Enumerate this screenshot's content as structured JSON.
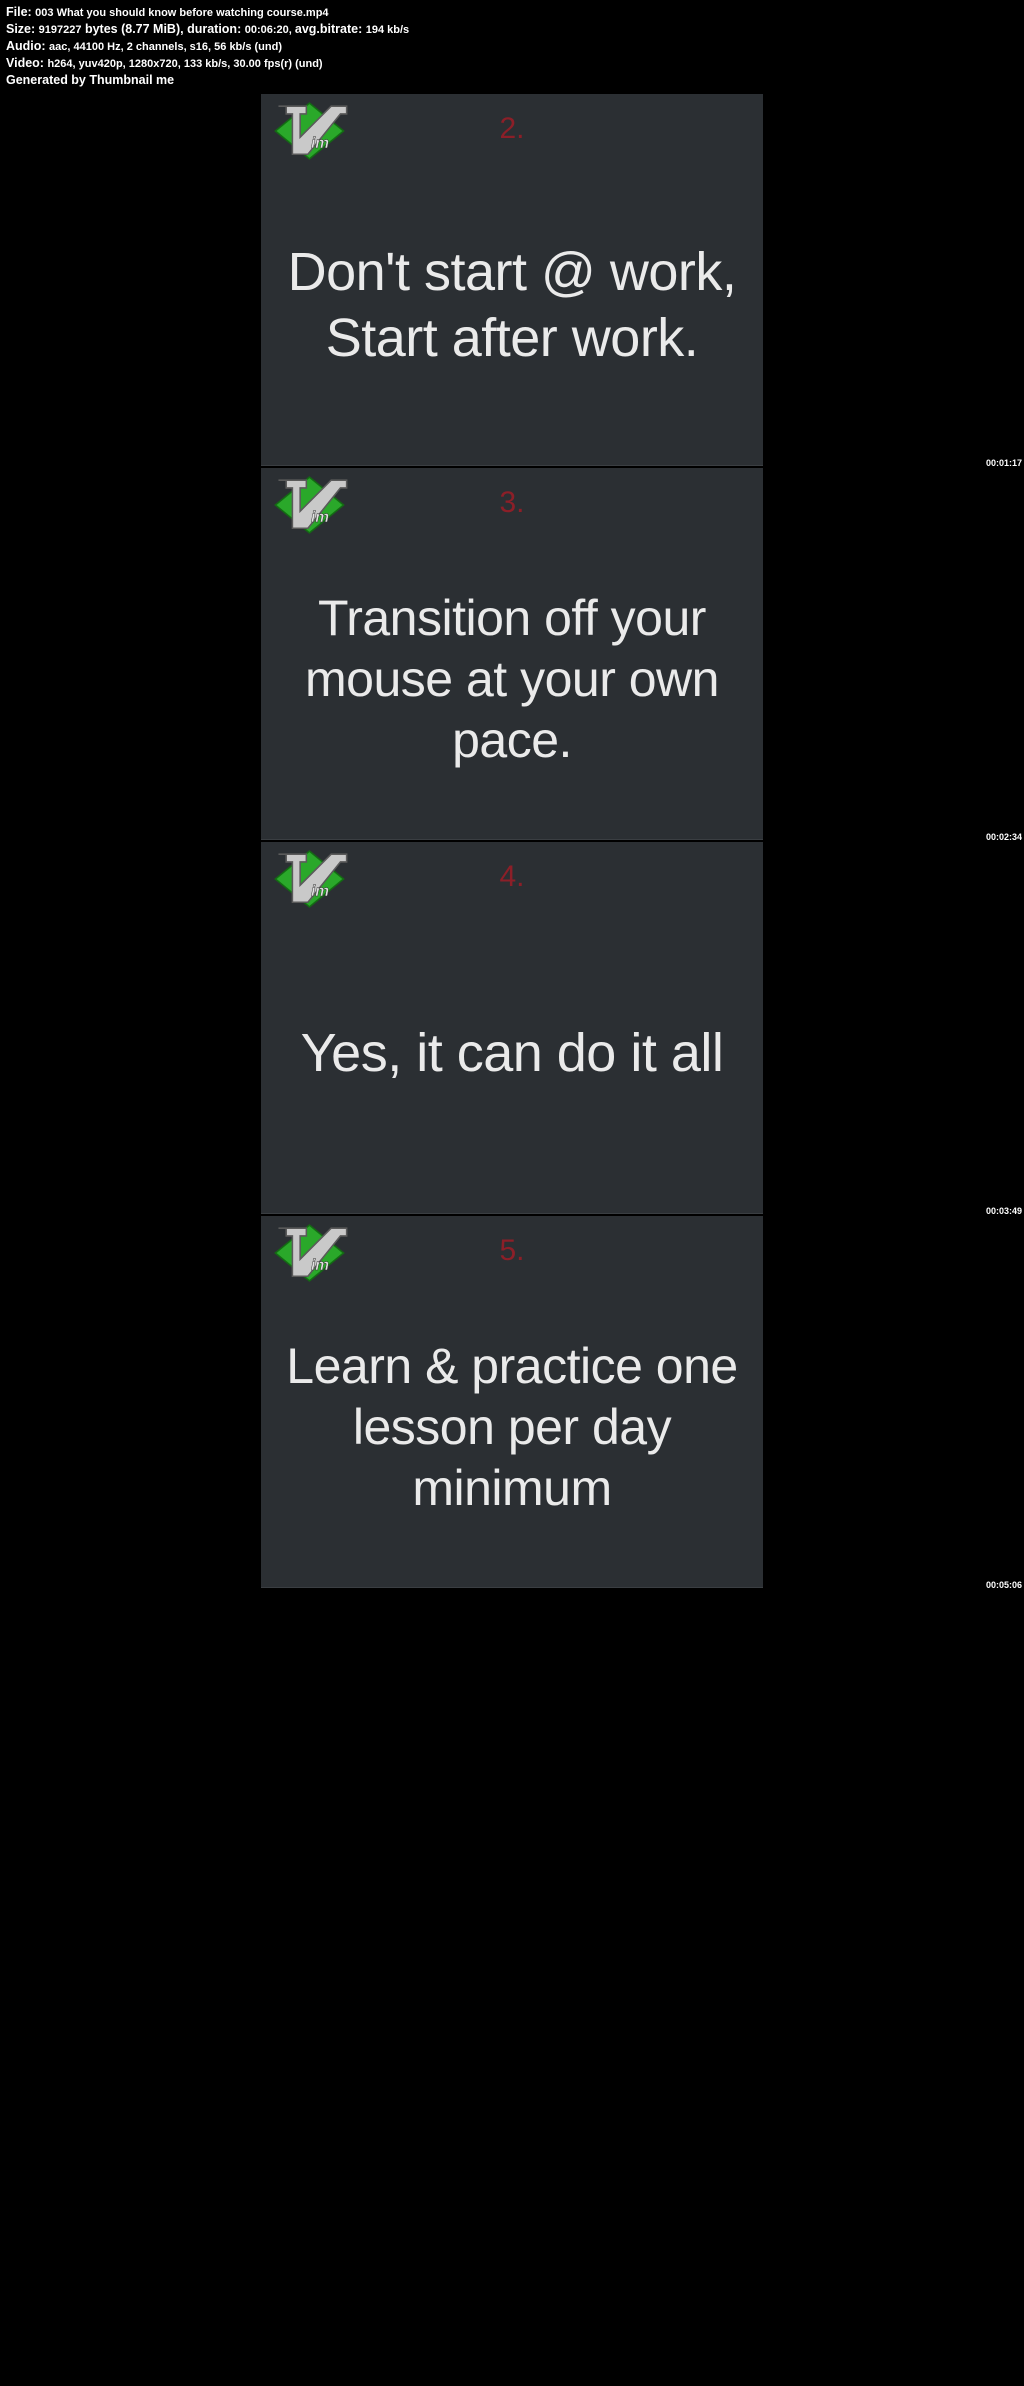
{
  "info": {
    "file_label": "File: ",
    "file": "003 What you should know before watching course.mp4",
    "size_label": "Size: ",
    "size_bytes": "9197227",
    "size_mib": " bytes (8.77 MiB), ",
    "duration_label": "duration: ",
    "duration": "00:06:20, ",
    "bitrate_label": "avg.bitrate: ",
    "bitrate": "194 kb/s",
    "audio_label": "Audio: ",
    "audio": "aac, 44100 Hz, 2 channels, s16, 56 kb/s (und)",
    "video_label": "Video: ",
    "video": "h264, yuv420p, 1280x720, 133 kb/s, 30.00 fps(r) (und)",
    "generated": "Generated by Thumbnail me"
  },
  "frames": [
    {
      "num": "2.",
      "tip": "Don't start @ work, Start after work.",
      "ts": "00:01:17",
      "smaller": false
    },
    {
      "num": "3.",
      "tip": "Transition off your mouse at your own pace.",
      "ts": "00:02:34",
      "smaller": true
    },
    {
      "num": "4.",
      "tip": "Yes, it can do it all",
      "ts": "00:03:49",
      "smaller": false
    },
    {
      "num": "5.",
      "tip": "Learn & practice one lesson per day minimum",
      "ts": "00:05:06",
      "smaller": true
    }
  ]
}
